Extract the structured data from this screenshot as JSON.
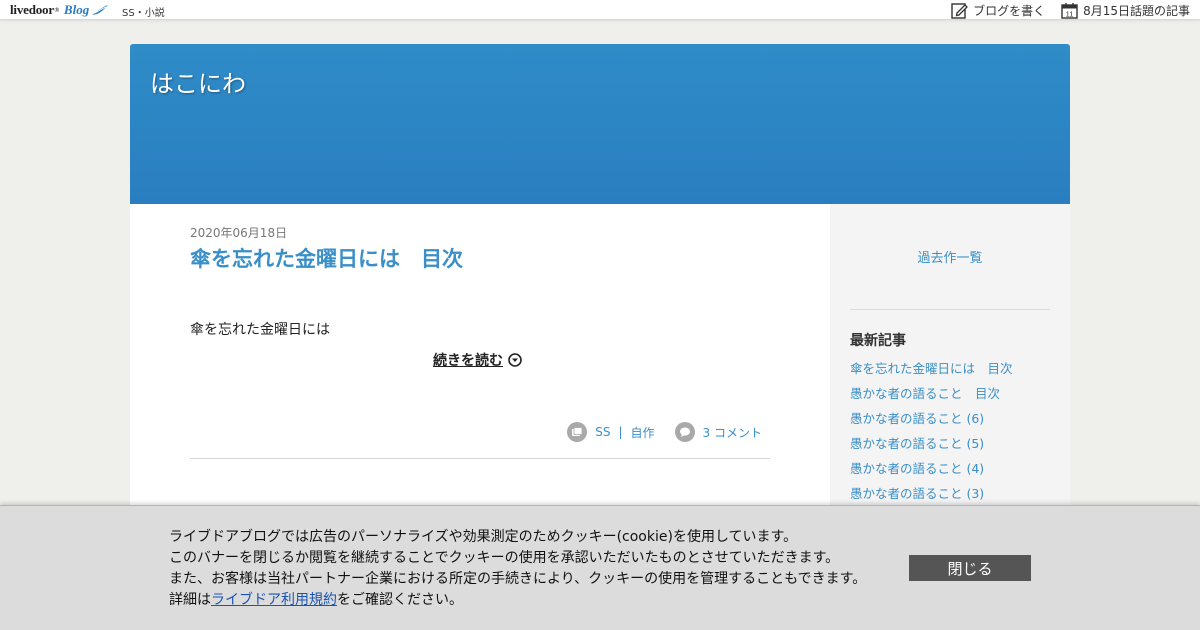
{
  "topbar": {
    "logo_text": "livedoor",
    "logo_blog": "Blog",
    "category": "SS・小説",
    "write_blog": "ブログを書く",
    "calendar_day": "11",
    "topics": "8月15日話題の記事"
  },
  "blog": {
    "title": "はこにわ"
  },
  "article": {
    "date": "2020年06月18日",
    "title": "傘を忘れた金曜日には　目次",
    "body": "傘を忘れた金曜日には",
    "read_more": "続きを読む",
    "category_ss": "SS",
    "category_sep": "|",
    "category_own": "自作",
    "comments": "3 コメント"
  },
  "sidebar": {
    "past_works": "過去作一覧",
    "recent_heading": "最新記事",
    "recent": [
      "傘を忘れた金曜日には　目次",
      "愚かな者の語ること　目次",
      "愚かな者の語ること (6)",
      "愚かな者の語ること (5)",
      "愚かな者の語ること (4)",
      "愚かな者の語ること (3)"
    ]
  },
  "cookie": {
    "line1": "ライブドアブログでは広告のパーソナライズや効果測定のためクッキー(cookie)を使用しています。",
    "line2": "このバナーを閉じるか閲覧を継続することでクッキーの使用を承認いただいたものとさせていただきます。",
    "line3": "また、お客様は当社パートナー企業における所定の手続きにより、クッキーの使用を管理することもできます。",
    "line4_prefix": "詳細は",
    "line4_link": "ライブドア利用規約",
    "line4_suffix": "をご確認ください。",
    "close": "閉じる"
  },
  "colors": {
    "header_blue": "#2f8cc7",
    "link_blue": "#3a8fc8",
    "close_button": "#555555"
  }
}
